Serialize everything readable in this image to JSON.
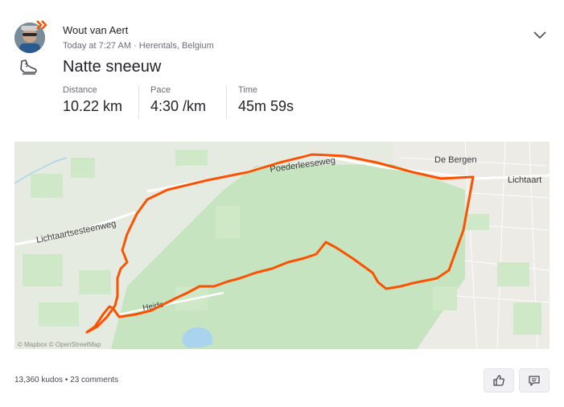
{
  "athlete": {
    "name": "Wout van Aert"
  },
  "activity": {
    "timestamp": "Today at 7:27 AM",
    "location": "Herentals, Belgium",
    "title": "Natte sneeuw",
    "sport_icon": "running-shoe-icon"
  },
  "stats": {
    "distance": {
      "label": "Distance",
      "value": "10.22 km"
    },
    "pace": {
      "label": "Pace",
      "value": "4:30 /km"
    },
    "time": {
      "label": "Time",
      "value": "45m 59s"
    }
  },
  "map": {
    "labels": {
      "road_left": "Lichtaartsesteenweg",
      "road_top": "Poederleeseweg",
      "road_bottom": "Heide",
      "place_top": "De Bergen",
      "place_right": "Lichtaart"
    },
    "attribution": "© Mapbox © OpenStreetMap",
    "route_color": "#fc5200",
    "forest_color": "#c5e4bf",
    "water_color": "#a9d3ee"
  },
  "social": {
    "kudos": "13,360 kudos",
    "separator": "•",
    "comments": "23 comments"
  },
  "icons": {
    "menu": "chevron-down-icon",
    "kudos": "thumbs-up-icon",
    "comment": "comment-icon"
  },
  "colors": {
    "accent": "#fc5200",
    "text": "#242428",
    "muted": "#6d6d78"
  }
}
